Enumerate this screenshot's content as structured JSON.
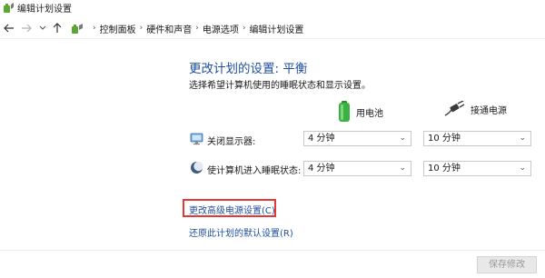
{
  "window": {
    "title": "编辑计划设置"
  },
  "nav": {
    "back_icon": "arrow-left",
    "forward_icon": "arrow-right",
    "up_icon": "arrow-up",
    "breadcrumbs": [
      "控制面板",
      "硬件和声音",
      "电源选项",
      "编辑计划设置"
    ]
  },
  "plan": {
    "title": "更改计划的设置: 平衡",
    "subtitle": "选择希望计算机使用的睡眠状态和显示设置。"
  },
  "columns": {
    "battery": "用电池",
    "plugged_in": "接通电源"
  },
  "settings": [
    {
      "label": "关闭显示器:",
      "battery_value": "4 分钟",
      "plugged_value": "10 分钟"
    },
    {
      "label": "使计算机进入睡眠状态:",
      "battery_value": "4 分钟",
      "plugged_value": "10 分钟"
    }
  ],
  "links": {
    "advanced": "更改高级电源设置(C)",
    "restore": "还原此计划的默认设置(R)"
  },
  "footer": {
    "save_label": "保存修改"
  },
  "colors": {
    "link": "#1f4e9e",
    "highlight": "#e53935",
    "battery_green": "#3cb043"
  }
}
